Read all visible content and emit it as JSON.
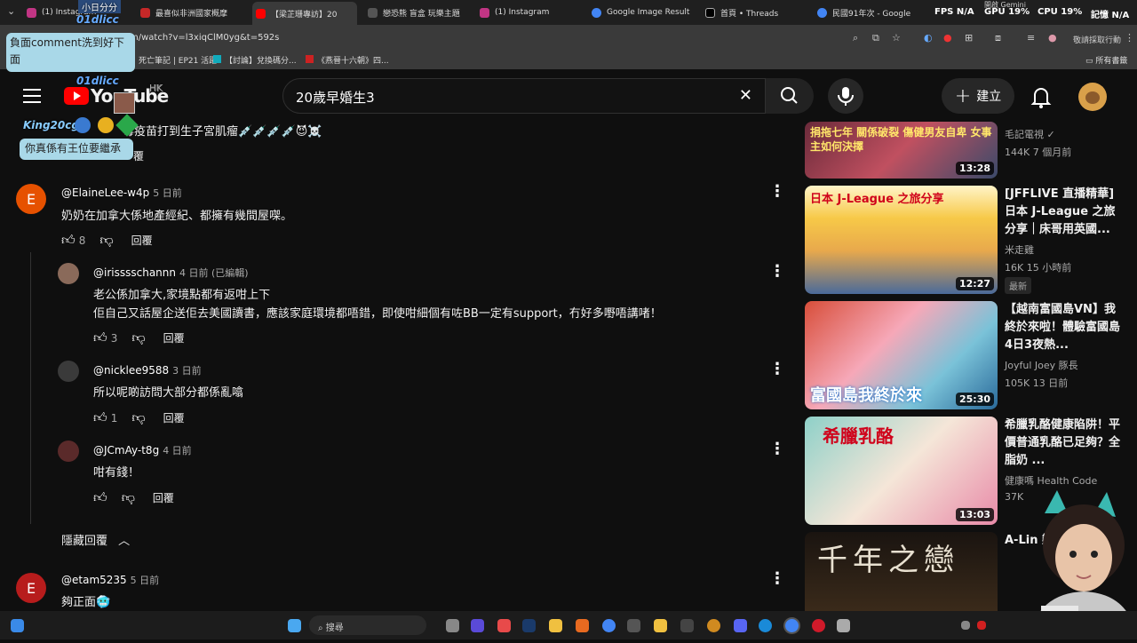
{
  "browser": {
    "tabs": [
      {
        "label": "(1) Instagram",
        "active": false
      },
      {
        "label": "最喜似非洲國家概摩",
        "active": false
      },
      {
        "label": "【梁芷珊專訪】20",
        "active": true
      },
      {
        "label": "戀恐熊 盲盒 玩樂主題",
        "active": false
      },
      {
        "label": "(1) Instagram",
        "active": false
      },
      {
        "label": "Google Image Result",
        "active": false
      },
      {
        "label": "首頁 • Threads",
        "active": false
      },
      {
        "label": "民國91年次 - Google",
        "active": false
      }
    ],
    "stats": {
      "fps_label": "FPS",
      "fps_value": "N/A",
      "gpu_label": "GPU",
      "gpu_value": "19%",
      "cpu_label": "CPU",
      "cpu_value": "19%",
      "extra_label": "記憶",
      "extra_value": "N/A",
      "gemini": "開啟 Gemini"
    },
    "url": "m/watch?v=l3xiqClM0yg&t=592s",
    "profile_button": "敬請採取行動",
    "bookmarks": [
      "死亡筆記 | EP21 活躍",
      "【討論】兌換碼分...",
      "《燕晉十六朝》四..."
    ],
    "all_bookmarks": "所有書籤"
  },
  "stream_overlay": {
    "chat_name_1": "01dlicc",
    "chat_msg_1": "負面comment洗到好下面",
    "chat_name_2": "01dlicc",
    "chat_sub_2": "HK",
    "chat_name_3": "King20cgs",
    "chat_msg_3": "你真係有王位要繼承",
    "top_fragment": "小日分分"
  },
  "youtube": {
    "logo": "YouTube",
    "logo_region": "HK",
    "search_value": "20歲早婚生3",
    "create_label": "建立"
  },
  "comments": {
    "top_fragment": "毒疫苗打到生子宮肌瘤💉💉💉💉😈☠️",
    "top_fragment_reply": "覆",
    "items": [
      {
        "handle": "@ElaineLee-w4p",
        "time": "5 日前",
        "text": "奶奶在加拿大係地產經紀、都擁有幾間屋㗎。",
        "likes": "8",
        "reply": "回覆",
        "avatar_letter": "E",
        "avatar_color": "#e65100"
      },
      {
        "handle": "@irisssschannn",
        "time": "4 日前 (已編輯)",
        "text_line1": "老公係加拿大,家境點都有返咁上下",
        "text_line2": "佢自己又話屋企送佢去美國讀書，應該家庭環境都唔錯，即使咁細個有咗BB一定有support，冇好多嘢唔講啫！",
        "likes": "3",
        "reply": "回覆"
      },
      {
        "handle": "@nicklee9588",
        "time": "3 日前",
        "text": "所以呢啲訪問大部分都係亂噏",
        "likes": "1",
        "reply": "回覆"
      },
      {
        "handle": "@JCmAy-t8g",
        "time": "4 日前",
        "text": "咁有錢！",
        "likes": "",
        "reply": "回覆"
      },
      {
        "handle": "@etam5235",
        "time": "5 日前",
        "text": "夠正面🥶",
        "avatar_letter": "E",
        "avatar_color": "#b71c1c"
      }
    ],
    "hide_replies": "隱藏回覆"
  },
  "sidebar": {
    "videos": [
      {
        "title": "",
        "channel": "毛記電視",
        "views": "144K",
        "age": "7 個月前",
        "duration": "13:28",
        "thumb_text": "捐拖七年 關係破裂 傷健男友自卑 女事主如何決擇"
      },
      {
        "title": "[JFFLIVE 直播精華] 日本 J-League 之旅分享｜床哥用英國...",
        "channel": "米走雞",
        "views": "16K",
        "age": "15 小時前",
        "badge": "最新",
        "duration": "12:27",
        "thumb_text": "日本 J-League 之旅分享"
      },
      {
        "title": "【越南富國島VN】我終於來啦！體驗富國島4日3夜熱...",
        "channel": "Joyful Joey 豚長",
        "views": "105K",
        "age": "13 日前",
        "duration": "25:30",
        "thumb_text": "富國島我終於來"
      },
      {
        "title": "希臘乳酪健康陷阱！平價普通乳酪已足夠？全脂奶 ...",
        "channel": "健康嗎 Health Code",
        "views": "37K",
        "age": "",
        "duration": "13:03",
        "thumb_text": "希臘乳酪"
      },
      {
        "title": "A-Lin 戀 現",
        "channel": "",
        "views": "",
        "age": "",
        "duration": "",
        "thumb_text": "千年之戀"
      }
    ]
  },
  "taskbar": {
    "search_label": "搜尋"
  }
}
